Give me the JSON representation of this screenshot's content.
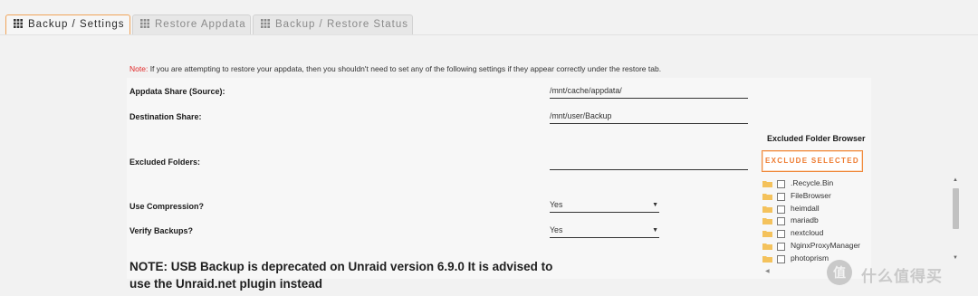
{
  "tabs": [
    {
      "label": "Backup / Settings",
      "active": true,
      "icon": "grid-icon"
    },
    {
      "label": "Restore Appdata",
      "active": false,
      "icon": "grid-icon"
    },
    {
      "label": "Backup / Restore Status",
      "active": false,
      "icon": "grid-icon"
    }
  ],
  "note": {
    "label": "Note:",
    "text": " If you are attempting to restore your appdata, then you shouldn't need to set any of the following settings if they appear correctly under the restore tab."
  },
  "settings": {
    "appdata_share": {
      "label": "Appdata Share (Source):",
      "value": "/mnt/cache/appdata/"
    },
    "destination_share": {
      "label": "Destination Share:",
      "value": "/mnt/user/Backup"
    },
    "excluded_folders": {
      "label": "Excluded Folders:",
      "value": ""
    },
    "use_compression": {
      "label": "Use Compression?",
      "value": "Yes"
    },
    "verify_backups": {
      "label": "Verify Backups?",
      "value": "Yes"
    }
  },
  "folder_browser": {
    "title": "Excluded Folder Browser",
    "exclude_button": "EXCLUDE SELECTED",
    "folders": [
      ".Recycle.Bin",
      "FileBrowser",
      "heimdall",
      "mariadb",
      "nextcloud",
      "NginxProxyManager",
      "photoprism"
    ]
  },
  "deprecation_notice": "NOTE: USB Backup is deprecated on Unraid version 6.9.0 It is advised to use the Unraid.net plugin instead",
  "watermark": {
    "text": "什么值得买",
    "icon": "smzdm-logo"
  },
  "colors": {
    "accent": "#f08a3c",
    "note_red": "#e22828",
    "folder_yellow": "#f4c25c"
  }
}
